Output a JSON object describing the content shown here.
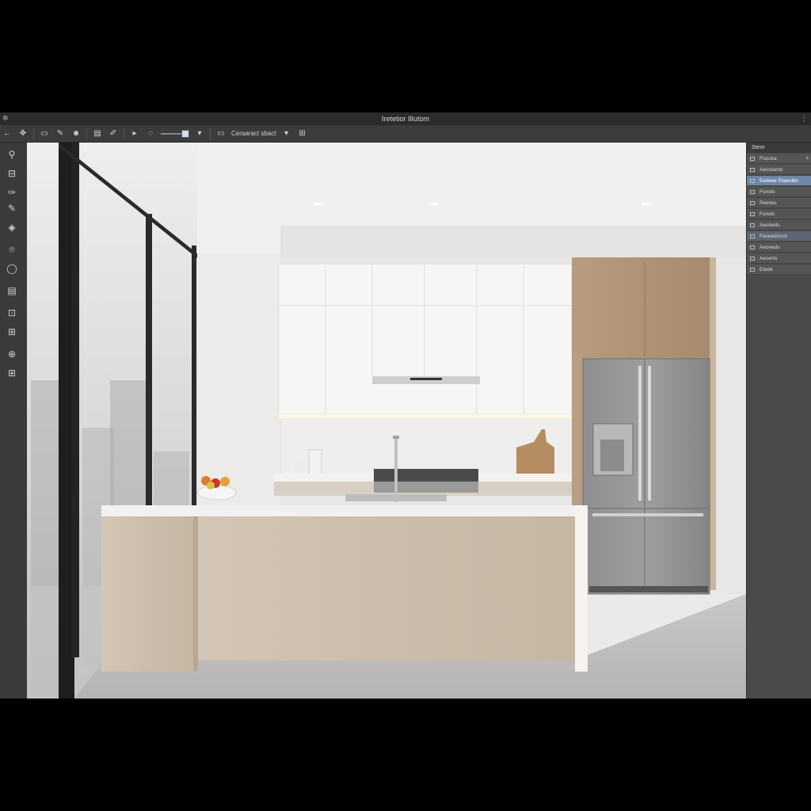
{
  "window": {
    "title": "Iretetior IlIutom"
  },
  "toolbar": {
    "items": [
      {
        "icon": "back-arrow-icon"
      },
      {
        "icon": "move-icon"
      },
      {
        "icon": "crop-icon"
      },
      {
        "icon": "brush-icon"
      },
      {
        "icon": "person-icon"
      },
      {
        "icon": "layers-icon"
      },
      {
        "icon": "pen-icon"
      },
      {
        "icon": "play-icon"
      }
    ],
    "slider_value": 1.0,
    "dropdown_label": "Ceraaract sbact",
    "accent": "#cfe0f5"
  },
  "left_tools": [
    {
      "icon": "zoom-icon"
    },
    {
      "icon": "select-icon"
    },
    {
      "icon": "eyedropper-icon"
    },
    {
      "icon": "pen-tool-icon"
    },
    {
      "icon": "target-icon"
    },
    {
      "icon": "lasso-icon"
    },
    {
      "icon": "search-icon"
    },
    {
      "icon": "layer-icon"
    },
    {
      "icon": "transform-icon"
    },
    {
      "icon": "grid-icon"
    },
    {
      "icon": "globe-icon"
    },
    {
      "icon": "table-icon"
    }
  ],
  "panel": {
    "title": "Stem",
    "items": [
      {
        "label": "Flocora",
        "state": "normal",
        "close": "x"
      },
      {
        "label": "Aeoctanst",
        "state": "normal"
      },
      {
        "label": "Eedwer Etaestlin",
        "state": "selected"
      },
      {
        "label": "Fonols",
        "state": "normal"
      },
      {
        "label": "Reinies",
        "state": "normal"
      },
      {
        "label": "Fonolc",
        "state": "normal"
      },
      {
        "label": "Aeoheds",
        "state": "normal"
      },
      {
        "label": "Feceedzesh",
        "state": "alt"
      },
      {
        "label": "Aeoneds",
        "state": "normal"
      },
      {
        "label": "Aeoerts",
        "state": "normal"
      },
      {
        "label": "Etede",
        "state": "normal"
      }
    ],
    "selected_color": "#6e87a8"
  },
  "canvas": {
    "subject": "kitchen-render-image"
  }
}
